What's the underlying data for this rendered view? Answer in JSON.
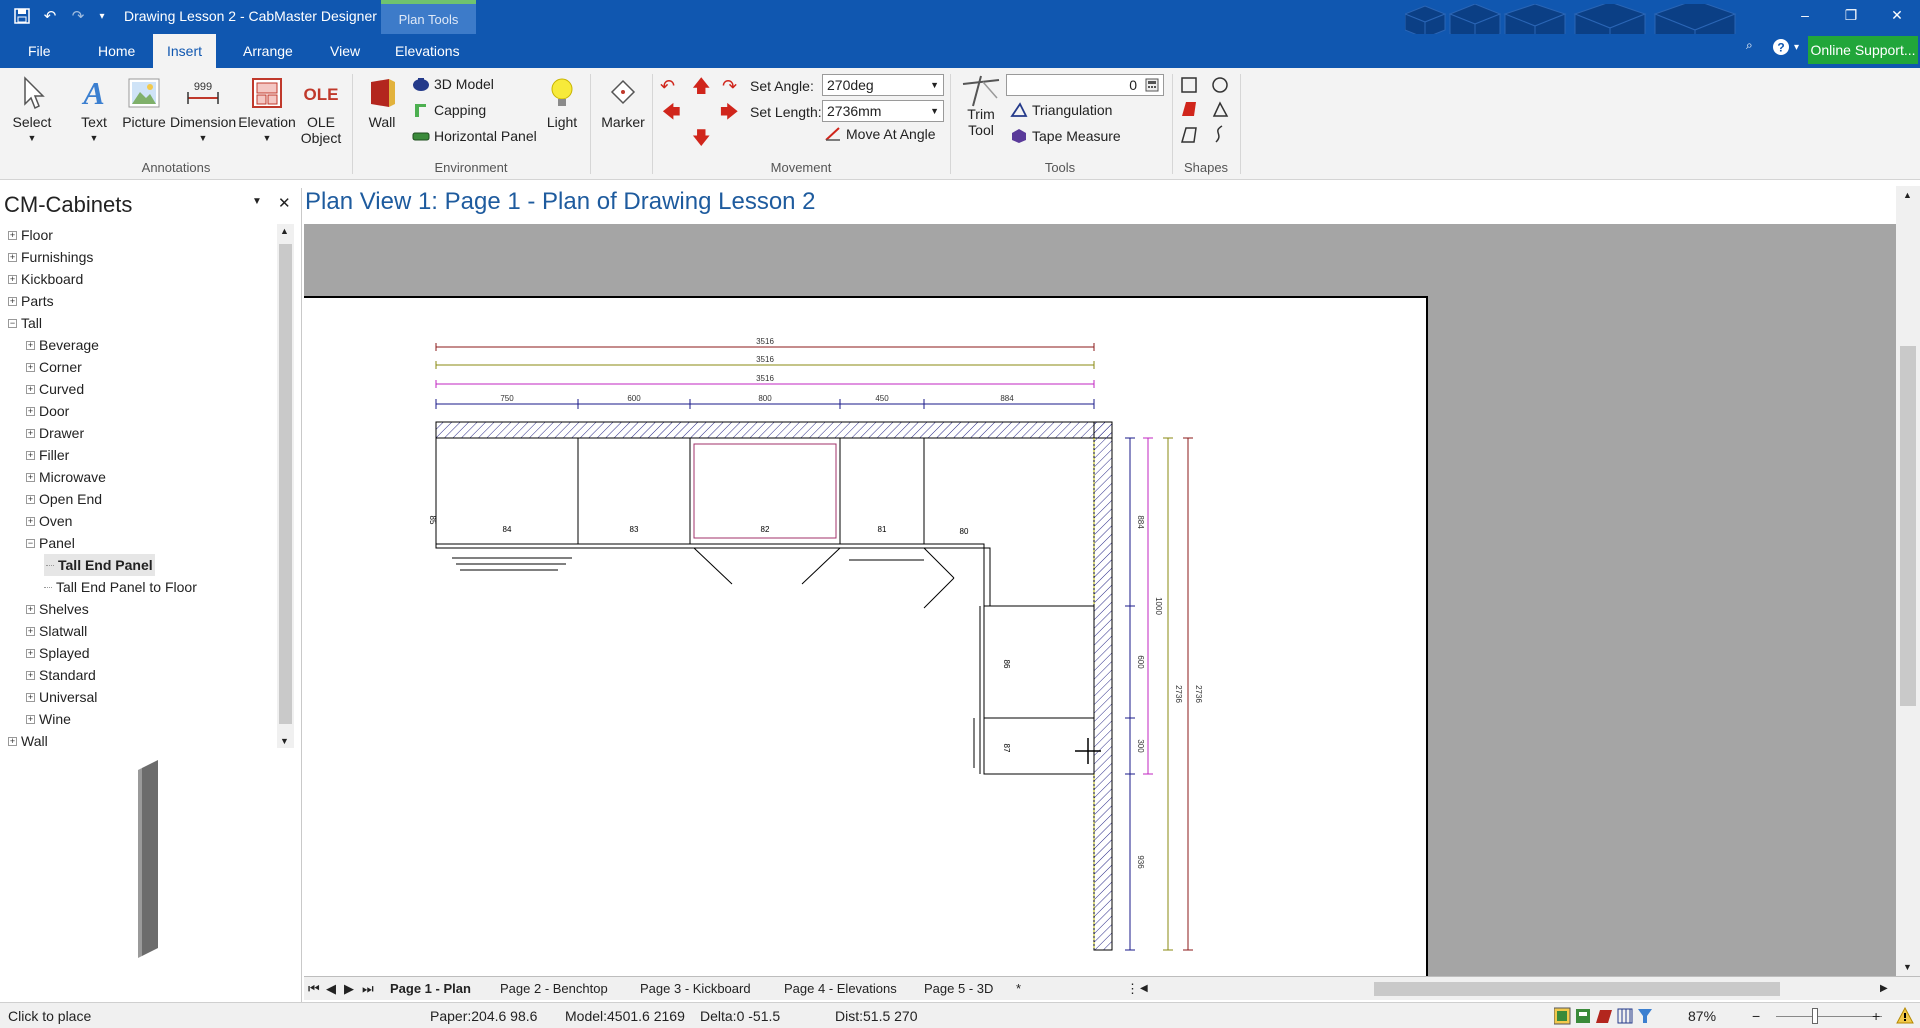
{
  "window": {
    "title": "Drawing Lesson 2 - CabMaster Designer",
    "context_tab": "Plan Tools",
    "minimize": "–",
    "restore": "❐",
    "close": "✕"
  },
  "ribbon_tabs": [
    "File",
    "Home",
    "Insert",
    "Arrange",
    "View",
    "Elevations"
  ],
  "online_support": "Online Support...",
  "ribbon": {
    "annotations": {
      "group": "Annotations",
      "select": "Select",
      "text": "Text",
      "picture": "Picture",
      "dimension": "Dimension",
      "dimension_glyph": "999",
      "elevation": "Elevation",
      "ole_line1": "OLE",
      "ole_line2": "Object",
      "ole_glyph": "OLE"
    },
    "environment": {
      "group": "Environment",
      "wall": "Wall",
      "model_3d": "3D Model",
      "capping": "Capping",
      "horizontal_panel": "Horizontal Panel",
      "light": "Light"
    },
    "marker": "Marker",
    "movement": {
      "group": "Movement",
      "set_angle_label": "Set Angle:",
      "set_angle_value": "270deg",
      "set_length_label": "Set Length:",
      "set_length_value": "2736mm",
      "move_at_angle": "Move At Angle"
    },
    "tools": {
      "group": "Tools",
      "trim_line1": "Trim",
      "trim_line2": "Tool",
      "numeric_value": "0",
      "triangulation": "Triangulation",
      "tape_measure": "Tape Measure"
    },
    "shapes": {
      "group": "Shapes"
    }
  },
  "left_panel": {
    "title": "CM-Cabinets",
    "tree": [
      {
        "label": "Floor",
        "level": 0,
        "state": "+"
      },
      {
        "label": "Furnishings",
        "level": 0,
        "state": "+"
      },
      {
        "label": "Kickboard",
        "level": 0,
        "state": "+"
      },
      {
        "label": "Parts",
        "level": 0,
        "state": "+"
      },
      {
        "label": "Tall",
        "level": 0,
        "state": "-"
      },
      {
        "label": "Beverage",
        "level": 1,
        "state": "+"
      },
      {
        "label": "Corner",
        "level": 1,
        "state": "+"
      },
      {
        "label": "Curved",
        "level": 1,
        "state": "+"
      },
      {
        "label": "Door",
        "level": 1,
        "state": "+"
      },
      {
        "label": "Drawer",
        "level": 1,
        "state": "+"
      },
      {
        "label": "Filler",
        "level": 1,
        "state": "+"
      },
      {
        "label": "Microwave",
        "level": 1,
        "state": "+"
      },
      {
        "label": "Open End",
        "level": 1,
        "state": "+"
      },
      {
        "label": "Oven",
        "level": 1,
        "state": "+"
      },
      {
        "label": "Panel",
        "level": 1,
        "state": "-"
      },
      {
        "label": "Tall End Panel",
        "level": 2,
        "state": "",
        "selected": true
      },
      {
        "label": "Tall End Panel to Floor",
        "level": 2,
        "state": ""
      },
      {
        "label": "Shelves",
        "level": 1,
        "state": "+"
      },
      {
        "label": "Slatwall",
        "level": 1,
        "state": "+"
      },
      {
        "label": "Splayed",
        "level": 1,
        "state": "+"
      },
      {
        "label": "Standard",
        "level": 1,
        "state": "+"
      },
      {
        "label": "Universal",
        "level": 1,
        "state": "+"
      },
      {
        "label": "Wine",
        "level": 1,
        "state": "+"
      },
      {
        "label": "Wall",
        "level": 0,
        "state": "+"
      }
    ]
  },
  "view_title": "Plan View 1: Page 1 - Plan of Drawing Lesson 2",
  "drawing": {
    "top_dims": [
      "3516",
      "3516",
      "3516"
    ],
    "segment_dims": [
      "750",
      "600",
      "800",
      "450",
      "884"
    ],
    "cabinet_numbers": [
      "84",
      "83",
      "82",
      "81",
      "80",
      "86",
      "87",
      "85"
    ],
    "right_dims": [
      "884",
      "1000",
      "600",
      "300",
      "936",
      "2736",
      "2736"
    ]
  },
  "page_tabs": [
    "Page 1 - Plan",
    "Page 2 - Benchtop",
    "Page 3 - Kickboard",
    "Page 4 - Elevations",
    "Page 5 - 3D",
    "*"
  ],
  "status": {
    "message": "Click to place",
    "paper": "Paper:204.6 98.6",
    "model": "Model:4501.6 2169",
    "delta": "Delta:0 -51.5",
    "dist": "Dist:51.5 270",
    "zoom": "87%"
  }
}
